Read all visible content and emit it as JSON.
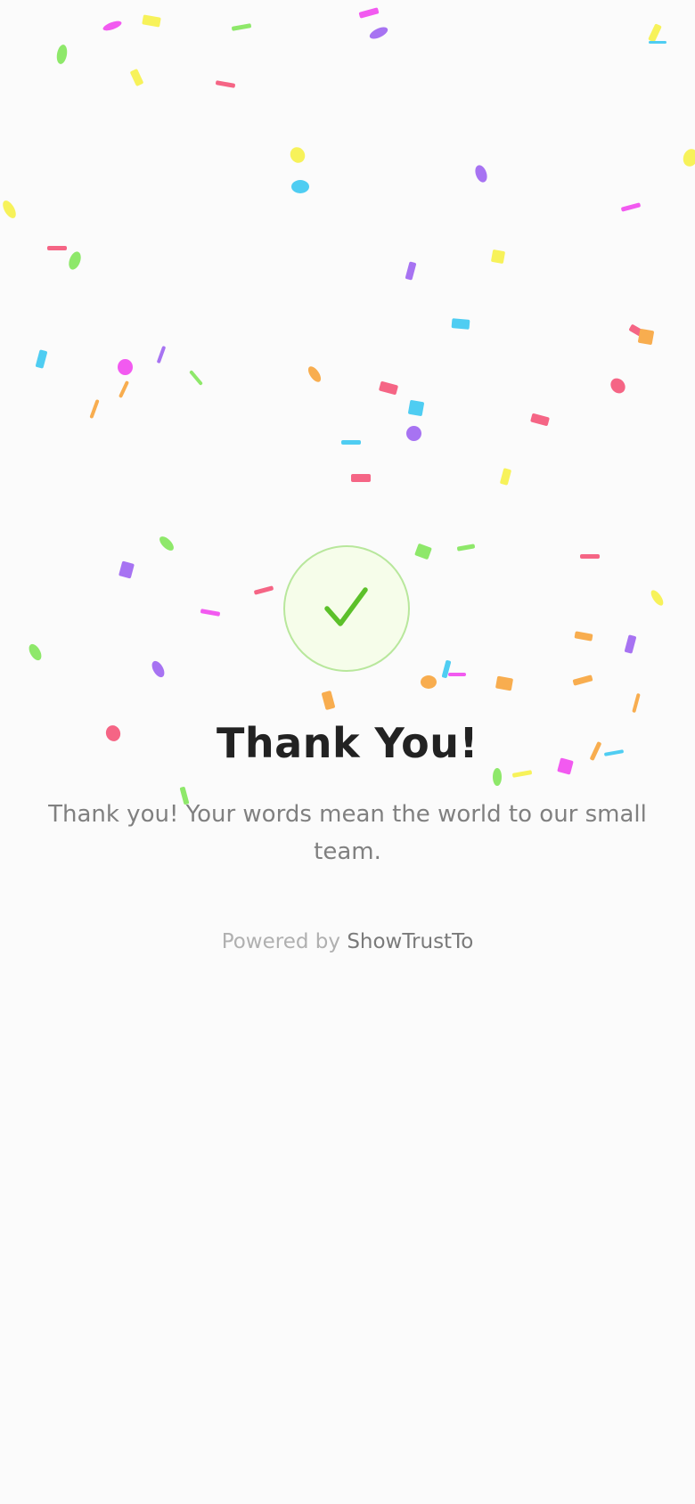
{
  "thank_you": {
    "title": "Thank You!",
    "message": "Thank you! Your words mean the world to our small team.",
    "powered_by_prefix": "Powered by",
    "powered_by_brand": "ShowTrustTo"
  },
  "success_badge": {
    "icon": "checkmark-icon",
    "check_color": "#5cc02a",
    "circle_fill": "#f6fdea",
    "circle_border": "#b8e79c"
  },
  "confetti_palette": {
    "yellow": "#f7f25a",
    "magenta": "#f25af0",
    "purple": "#a773f2",
    "green": "#8ee86a",
    "cyan": "#4fcdf2",
    "red": "#f56585",
    "orange": "#f8ad4f"
  }
}
